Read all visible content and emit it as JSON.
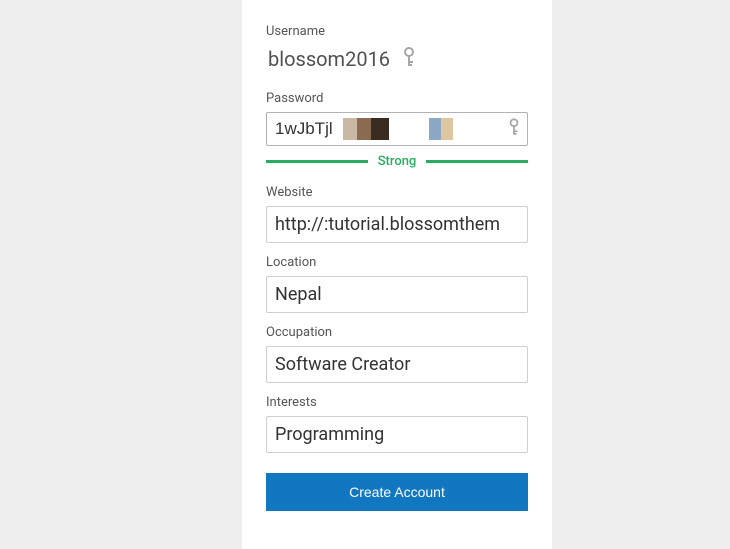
{
  "form": {
    "username": {
      "label": "Username",
      "value": "blossom2016"
    },
    "password": {
      "label": "Password",
      "value": "1wJbTjl",
      "strength_label": "Strong",
      "strength_color": "#27ae60"
    },
    "website": {
      "label": "Website",
      "value": "http://:tutorial.blossomthem"
    },
    "location": {
      "label": "Location",
      "value": "Nepal"
    },
    "occupation": {
      "label": "Occupation",
      "value": "Software Creator"
    },
    "interests": {
      "label": "Interests",
      "value": "Programming"
    },
    "submit_label": "Create Account"
  },
  "icons": {
    "key": "key-icon"
  }
}
